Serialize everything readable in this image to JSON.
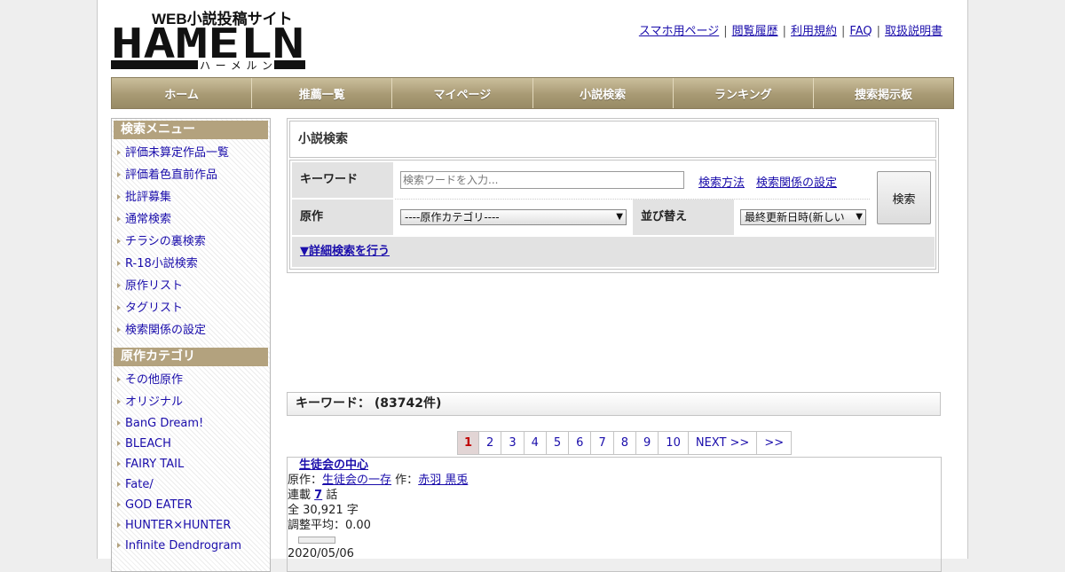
{
  "logo": {
    "main_text": "HAMELN",
    "tagline": "WEB小説投稿サイト",
    "kana": "ハーメルン"
  },
  "top_links": [
    "スマホ用ページ",
    "閲覧履歴",
    "利用規約",
    "FAQ",
    "取扱説明書"
  ],
  "nav": [
    "ホーム",
    "推薦一覧",
    "マイページ",
    "小説検索",
    "ランキング",
    "捜索掲示板"
  ],
  "sidebar": {
    "menu_title": "検索メニュー",
    "menu_items": [
      "評価未算定作品一覧",
      "評価着色直前作品",
      "批評募集",
      "通常検索",
      "チラシの裏検索",
      "R-18小説検索",
      "原作リスト",
      "タグリスト",
      "検索関係の設定"
    ],
    "category_title": "原作カテゴリ",
    "categories": [
      "その他原作",
      "オリジナル",
      "BanG Dream!",
      "BLEACH",
      "FAIRY TAIL",
      "Fate/",
      "GOD EATER",
      "HUNTER×HUNTER",
      "Infinite Dendrogram"
    ]
  },
  "search": {
    "title": "小説検索",
    "keyword_label": "キーワード",
    "keyword_placeholder": "検索ワードを入力...",
    "help_link": "検索方法",
    "settings_link": "検索関係の設定",
    "original_label": "原作",
    "original_select": "----原作カテゴリ----",
    "sort_label": "並び替え",
    "sort_select": "最終更新日時(新しい",
    "submit": "検索",
    "advanced": "▼詳細検索を行う"
  },
  "results": {
    "header": "キーワード： (83742件)",
    "pages": [
      "1",
      "2",
      "3",
      "4",
      "5",
      "6",
      "7",
      "8",
      "9",
      "10",
      "NEXT >>",
      ">>"
    ],
    "current_page": "1",
    "item": {
      "title": "生徒会の中心",
      "original_prefix": "原作：",
      "original": "生徒会の一存",
      "author_prefix": "作：",
      "author": "赤羽 黒兎",
      "episodes_prefix": "連載",
      "episodes": "7",
      "episodes_suffix": "話",
      "chars": "全 30,921 字",
      "rating": "調整平均：0.00",
      "date": "2020/05/06"
    }
  },
  "colors": {
    "nav_bg": "#a89a74",
    "sidebar_header": "#b3a27e",
    "link": "#1a0dab",
    "current_page": "#c00000"
  }
}
